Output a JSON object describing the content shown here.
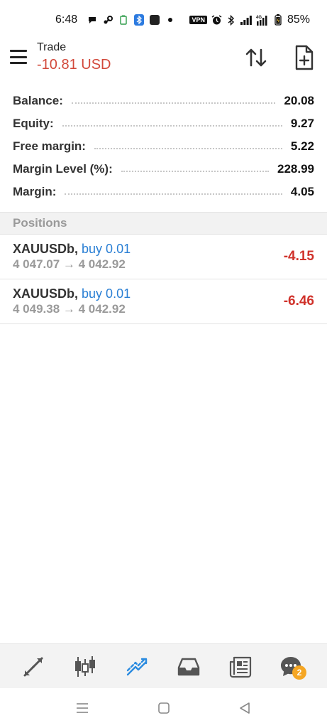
{
  "status_bar": {
    "time": "6:48",
    "battery": "85%",
    "icons_left": [
      "chat-icon",
      "steam-icon",
      "battery-saver-icon",
      "bluetooth-app-icon",
      "dark-app-icon",
      "dot-icon"
    ],
    "icons_right": [
      "vpn-icon",
      "alarm-icon",
      "bluetooth-icon",
      "signal-icon",
      "4g-signal-icon",
      "battery-icon"
    ],
    "vpn_label": "VPN"
  },
  "header": {
    "title": "Trade",
    "profit": "-10.81 USD",
    "profit_color": "#d2483a"
  },
  "summary": [
    {
      "label": "Balance:",
      "value": "20.08"
    },
    {
      "label": "Equity:",
      "value": "9.27"
    },
    {
      "label": "Free margin:",
      "value": "5.22"
    },
    {
      "label": "Margin Level (%):",
      "value": "228.99"
    },
    {
      "label": "Margin:",
      "value": "4.05"
    }
  ],
  "positions": {
    "header": "Positions",
    "items": [
      {
        "symbol": "XAUUSDb,",
        "side": "buy 0.01",
        "prices": "4 047.07 → 4 042.92",
        "profit": "-4.15"
      },
      {
        "symbol": "XAUUSDb,",
        "side": "buy 0.01",
        "prices": "4 049.38 → 4 042.92",
        "profit": "-6.46"
      }
    ]
  },
  "tabbar": {
    "tabs": [
      "quotes-icon",
      "chart-icon",
      "trade-icon",
      "history-icon",
      "news-icon",
      "messages-icon"
    ],
    "active_tab": "trade-icon",
    "active_color": "#2a8be0",
    "messages_badge": "2"
  },
  "colors": {
    "negative": "#d0322b",
    "side_blue": "#2a7fd4",
    "badge": "#f5a623"
  }
}
